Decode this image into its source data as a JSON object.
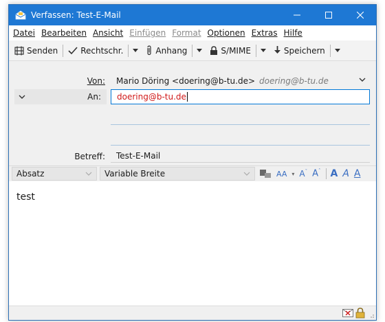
{
  "window": {
    "title": "Verfassen: Test-E-Mail"
  },
  "menu": [
    {
      "label": "Datei",
      "enabled": true
    },
    {
      "label": "Bearbeiten",
      "enabled": true
    },
    {
      "label": "Ansicht",
      "enabled": true
    },
    {
      "label": "Einfügen",
      "enabled": false
    },
    {
      "label": "Format",
      "enabled": false
    },
    {
      "label": "Optionen",
      "enabled": true
    },
    {
      "label": "Extras",
      "enabled": true
    },
    {
      "label": "Hilfe",
      "enabled": true
    }
  ],
  "toolbar": {
    "send": "Senden",
    "spell": "Rechtschr.",
    "attach": "Anhang",
    "smime": "S/MIME",
    "save": "Speichern"
  },
  "header": {
    "from_label": "Von:",
    "from_name": "Mario Döring <doering@b-tu.de>",
    "from_email": "doering@b-tu.de",
    "to_label": "An:",
    "to_value": "doering@b-tu.de",
    "subject_label": "Betreff:",
    "subject_value": "Test-E-Mail"
  },
  "format": {
    "paragraph": "Absatz",
    "font": "Variable Breite"
  },
  "body": {
    "text": "test"
  },
  "colors": {
    "titlebar": "#1e78d4",
    "recipient_text": "#d01818",
    "accent": "#0078d7"
  }
}
